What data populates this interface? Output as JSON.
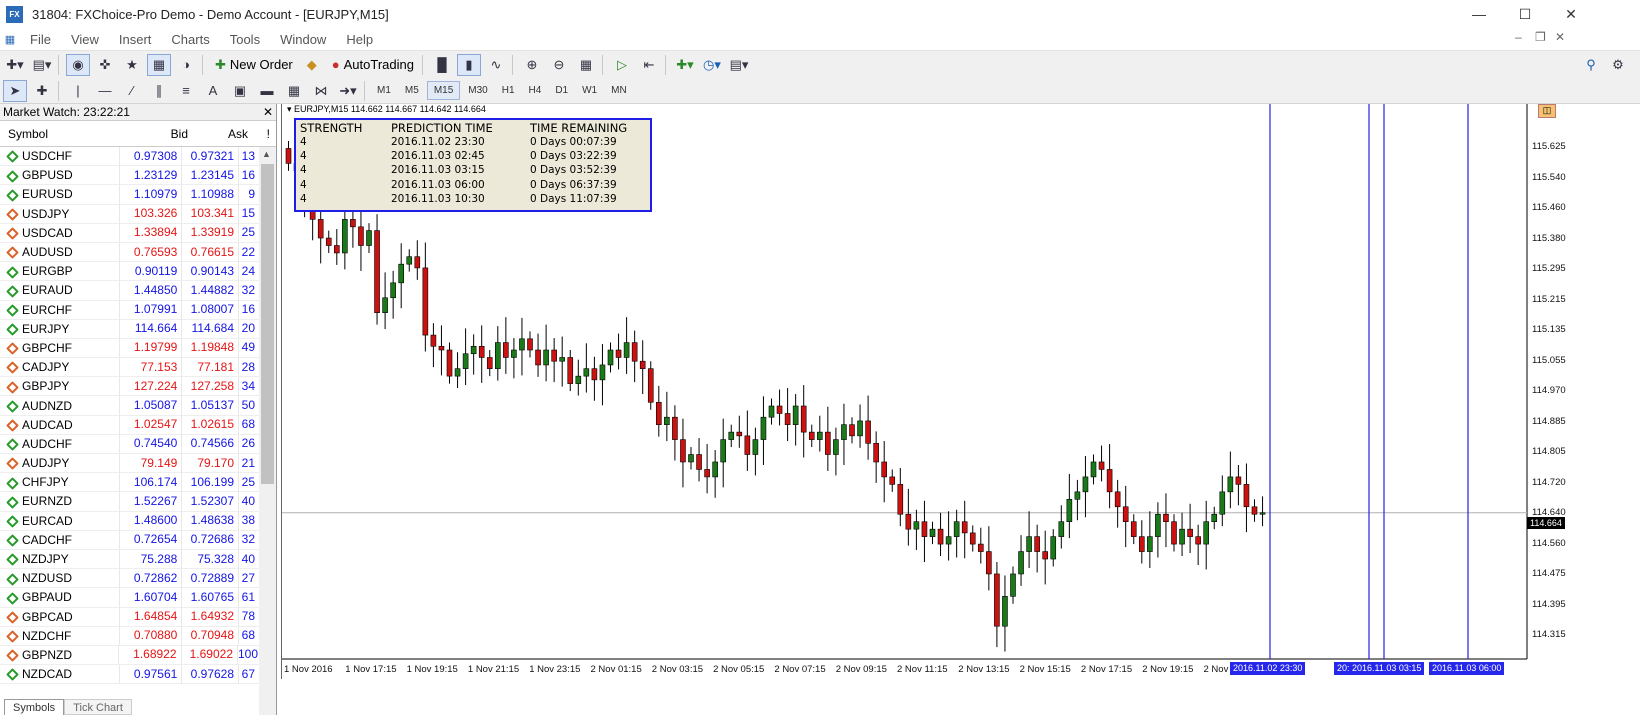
{
  "window": {
    "title": "31804: FXChoice-Pro Demo - Demo Account - [EURJPY,M15]",
    "app_icon": "FX"
  },
  "menu": [
    "File",
    "View",
    "Insert",
    "Charts",
    "Tools",
    "Window",
    "Help"
  ],
  "toolbar": {
    "new_order": "New Order",
    "autotrading": "AutoTrading"
  },
  "timeframes": [
    "M1",
    "M5",
    "M15",
    "M30",
    "H1",
    "H4",
    "D1",
    "W1",
    "MN"
  ],
  "active_timeframe": "M15",
  "market_watch": {
    "title": "Market Watch: 23:22:21",
    "columns": {
      "symbol": "Symbol",
      "bid": "Bid",
      "ask": "Ask",
      "spread": "!"
    },
    "rows": [
      {
        "symbol": "USDCHF",
        "bid": "0.97308",
        "ask": "0.97321",
        "spread": "13",
        "dir": "up"
      },
      {
        "symbol": "GBPUSD",
        "bid": "1.23129",
        "ask": "1.23145",
        "spread": "16",
        "dir": "up"
      },
      {
        "symbol": "EURUSD",
        "bid": "1.10979",
        "ask": "1.10988",
        "spread": "9",
        "dir": "up"
      },
      {
        "symbol": "USDJPY",
        "bid": "103.326",
        "ask": "103.341",
        "spread": "15",
        "dir": "down"
      },
      {
        "symbol": "USDCAD",
        "bid": "1.33894",
        "ask": "1.33919",
        "spread": "25",
        "dir": "down"
      },
      {
        "symbol": "AUDUSD",
        "bid": "0.76593",
        "ask": "0.76615",
        "spread": "22",
        "dir": "down"
      },
      {
        "symbol": "EURGBP",
        "bid": "0.90119",
        "ask": "0.90143",
        "spread": "24",
        "dir": "up"
      },
      {
        "symbol": "EURAUD",
        "bid": "1.44850",
        "ask": "1.44882",
        "spread": "32",
        "dir": "up"
      },
      {
        "symbol": "EURCHF",
        "bid": "1.07991",
        "ask": "1.08007",
        "spread": "16",
        "dir": "up"
      },
      {
        "symbol": "EURJPY",
        "bid": "114.664",
        "ask": "114.684",
        "spread": "20",
        "dir": "up"
      },
      {
        "symbol": "GBPCHF",
        "bid": "1.19799",
        "ask": "1.19848",
        "spread": "49",
        "dir": "down"
      },
      {
        "symbol": "CADJPY",
        "bid": "77.153",
        "ask": "77.181",
        "spread": "28",
        "dir": "down"
      },
      {
        "symbol": "GBPJPY",
        "bid": "127.224",
        "ask": "127.258",
        "spread": "34",
        "dir": "down"
      },
      {
        "symbol": "AUDNZD",
        "bid": "1.05087",
        "ask": "1.05137",
        "spread": "50",
        "dir": "up"
      },
      {
        "symbol": "AUDCAD",
        "bid": "1.02547",
        "ask": "1.02615",
        "spread": "68",
        "dir": "down"
      },
      {
        "symbol": "AUDCHF",
        "bid": "0.74540",
        "ask": "0.74566",
        "spread": "26",
        "dir": "up"
      },
      {
        "symbol": "AUDJPY",
        "bid": "79.149",
        "ask": "79.170",
        "spread": "21",
        "dir": "down"
      },
      {
        "symbol": "CHFJPY",
        "bid": "106.174",
        "ask": "106.199",
        "spread": "25",
        "dir": "up"
      },
      {
        "symbol": "EURNZD",
        "bid": "1.52267",
        "ask": "1.52307",
        "spread": "40",
        "dir": "up"
      },
      {
        "symbol": "EURCAD",
        "bid": "1.48600",
        "ask": "1.48638",
        "spread": "38",
        "dir": "up"
      },
      {
        "symbol": "CADCHF",
        "bid": "0.72654",
        "ask": "0.72686",
        "spread": "32",
        "dir": "up"
      },
      {
        "symbol": "NZDJPY",
        "bid": "75.288",
        "ask": "75.328",
        "spread": "40",
        "dir": "up"
      },
      {
        "symbol": "NZDUSD",
        "bid": "0.72862",
        "ask": "0.72889",
        "spread": "27",
        "dir": "up"
      },
      {
        "symbol": "GBPAUD",
        "bid": "1.60704",
        "ask": "1.60765",
        "spread": "61",
        "dir": "up"
      },
      {
        "symbol": "GBPCAD",
        "bid": "1.64854",
        "ask": "1.64932",
        "spread": "78",
        "dir": "down"
      },
      {
        "symbol": "NZDCHF",
        "bid": "0.70880",
        "ask": "0.70948",
        "spread": "68",
        "dir": "down"
      },
      {
        "symbol": "GBPNZD",
        "bid": "1.68922",
        "ask": "1.69022",
        "spread": "100",
        "dir": "down"
      },
      {
        "symbol": "NZDCAD",
        "bid": "0.97561",
        "ask": "0.97628",
        "spread": "67",
        "dir": "up"
      }
    ],
    "tabs": [
      "Symbols",
      "Tick Chart"
    ]
  },
  "colors": {
    "up_price": "#1414e6",
    "down_price": "#e61414",
    "bull_candle": "#1a7a1a",
    "bear_candle": "#cc1111",
    "marker_line": "#2424e0"
  },
  "chart": {
    "info": "EURJPY,M15  114.662 114.667 114.642 114.664",
    "current_price": "114.664",
    "y_ticks": [
      "115.625",
      "115.540",
      "115.460",
      "115.380",
      "115.295",
      "115.215",
      "115.135",
      "115.055",
      "114.970",
      "114.885",
      "114.805",
      "114.720",
      "114.640",
      "114.560",
      "114.475",
      "114.395",
      "114.315"
    ],
    "x_ticks": [
      "1 Nov 2016",
      "1 Nov 17:15",
      "1 Nov 19:15",
      "1 Nov 21:15",
      "1 Nov 23:15",
      "2 Nov 01:15",
      "2 Nov 03:15",
      "2 Nov 05:15",
      "2 Nov 07:15",
      "2 Nov 09:15",
      "2 Nov 11:15",
      "2 Nov 13:15",
      "2 Nov 15:15",
      "2 Nov 17:15",
      "2 Nov 19:15",
      "2 Nov 2"
    ],
    "vline_tags": [
      "2016.11.02 23:30",
      "20: 2016.11.03 03:15",
      "2016.11.03 06:00"
    ],
    "prediction": {
      "headers": [
        "STRENGTH",
        "PREDICTION TIME",
        "TIME REMAINING"
      ],
      "rows": [
        [
          "4",
          "2016.11.02 23:30",
          "0 Days 00:07:39"
        ],
        [
          "4",
          "2016.11.03 02:45",
          "0 Days 03:22:39"
        ],
        [
          "4",
          "2016.11.03 03:15",
          "0 Days 03:52:39"
        ],
        [
          "4",
          "2016.11.03 06:00",
          "0 Days 06:37:39"
        ],
        [
          "4",
          "2016.11.03 10:30",
          "0 Days 11:07:39"
        ]
      ]
    }
  },
  "chart_data": {
    "type": "candlestick",
    "symbol": "EURJPY",
    "timeframe": "M15",
    "ylim": [
      114.315,
      115.66
    ],
    "close": [
      115.6,
      115.58,
      115.5,
      115.45,
      115.4,
      115.38,
      115.36,
      115.45,
      115.43,
      115.38,
      115.42,
      115.2,
      115.24,
      115.28,
      115.33,
      115.35,
      115.32,
      115.14,
      115.11,
      115.1,
      115.03,
      115.05,
      115.09,
      115.11,
      115.08,
      115.05,
      115.12,
      115.08,
      115.1,
      115.13,
      115.1,
      115.06,
      115.1,
      115.07,
      115.08,
      115.01,
      115.03,
      115.05,
      115.02,
      115.06,
      115.1,
      115.08,
      115.12,
      115.07,
      115.05,
      114.96,
      114.9,
      114.92,
      114.86,
      114.8,
      114.82,
      114.78,
      114.76,
      114.8,
      114.86,
      114.88,
      114.87,
      114.82,
      114.86,
      114.92,
      114.95,
      114.93,
      114.9,
      114.95,
      114.88,
      114.86,
      114.88,
      114.82,
      114.86,
      114.9,
      114.87,
      114.91,
      114.85,
      114.8,
      114.76,
      114.74,
      114.66,
      114.62,
      114.64,
      114.6,
      114.62,
      114.58,
      114.6,
      114.64,
      114.61,
      114.58,
      114.56,
      114.5,
      114.36,
      114.44,
      114.5,
      114.56,
      114.6,
      114.56,
      114.54,
      114.6,
      114.64,
      114.7,
      114.72,
      114.76,
      114.8,
      114.78,
      114.72,
      114.68,
      114.64,
      114.6,
      114.56,
      114.6,
      114.66,
      114.64,
      114.58,
      114.62,
      114.6,
      114.58,
      114.64,
      114.66,
      114.72,
      114.76,
      114.74,
      114.68,
      114.66,
      114.664
    ]
  }
}
